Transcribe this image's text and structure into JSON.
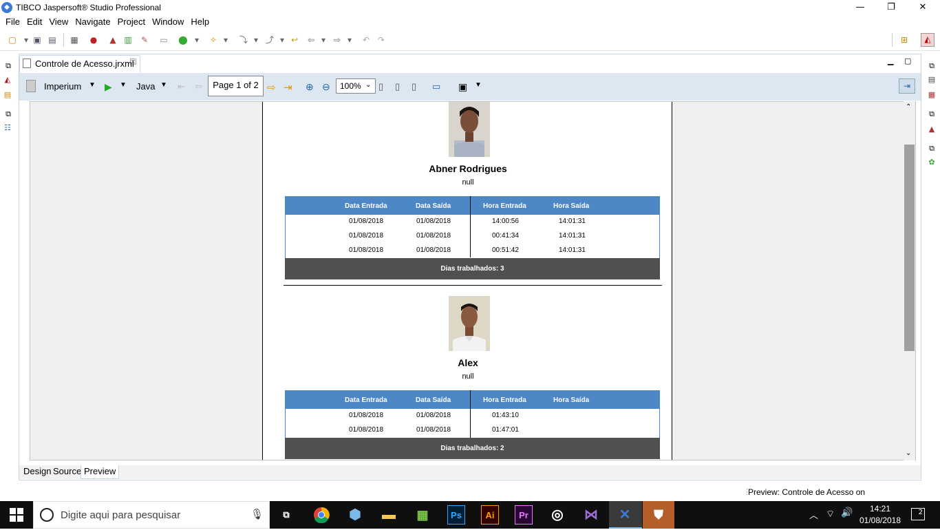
{
  "window": {
    "title": "TIBCO Jaspersoft® Studio Professional",
    "minimize": "—",
    "maximize": "❐",
    "close": "✕"
  },
  "menu": [
    "File",
    "Edit",
    "View",
    "Navigate",
    "Project",
    "Window",
    "Help"
  ],
  "editor_tab": {
    "label": "Controle de Acesso.jrxml",
    "close": "☒"
  },
  "preview_toolbar": {
    "data_adapter": "Imperium",
    "language": "Java",
    "page_indicator": "Page 1 of 2",
    "zoom": "100%"
  },
  "report": {
    "columns": [
      "Data Entrada",
      "Data Saída",
      "Hora Entrada",
      "Hora Saída"
    ],
    "employees": [
      {
        "name": "Abner Rodrigues",
        "role": "null",
        "rows": [
          [
            "01/08/2018",
            "01/08/2018",
            "14:00:56",
            "14:01:31"
          ],
          [
            "01/08/2018",
            "01/08/2018",
            "00:41:34",
            "14:01:31"
          ],
          [
            "01/08/2018",
            "01/08/2018",
            "00:51:42",
            "14:01:31"
          ]
        ],
        "footer": "Dias trabalhados: 3"
      },
      {
        "name": "Alex",
        "role": "null",
        "rows": [
          [
            "01/08/2018",
            "01/08/2018",
            "01:43:10",
            ""
          ],
          [
            "01/08/2018",
            "01/08/2018",
            "01:47:01",
            ""
          ]
        ],
        "footer": "Dias trabalhados: 2"
      }
    ]
  },
  "bottom_tabs": [
    "Design",
    "Source",
    "Preview"
  ],
  "status": "Preview: Controle de Acesso on",
  "taskbar": {
    "search_placeholder": "Digite aqui para pesquisar",
    "time": "14:21",
    "date": "01/08/2018",
    "notifications": "2",
    "apps": [
      "task-view",
      "chrome",
      "virtualbox",
      "file-explorer",
      "android-studio",
      "Ps",
      "Ai",
      "Pr",
      "steam",
      "visual-studio",
      "jaspersoft",
      "brave"
    ]
  },
  "colors": {
    "accent": "#4d87c6",
    "footer": "#505050",
    "toolbar": "#dde7f2"
  }
}
